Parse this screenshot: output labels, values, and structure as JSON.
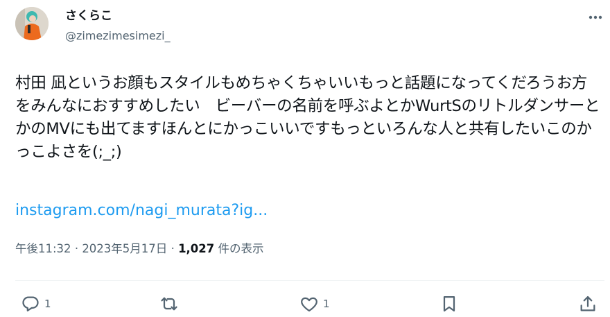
{
  "author": {
    "display_name": "さくらこ",
    "handle": "@zimezimesimezi_"
  },
  "tweet": {
    "text": "村田 凪というお顔もスタイルもめちゃくちゃいいもっと話題になってくだろうお方をみんなにおすすめしたい　ビーバーの名前を呼ぶよとかWurtSのリトルダンサーとかのMVにも出てますほんとにかっこいいですもっといろんな人と共有したいこのかっこよさを(;_;)",
    "link_text": "instagram.com/nagi_murata?ig...",
    "time": "午後11:32",
    "separator": "·",
    "date": "2023年5月17日",
    "views_count": "1,027",
    "views_label": "件の表示"
  },
  "actions": {
    "reply_count": "1",
    "like_count": "1"
  },
  "icons": [
    "more-icon",
    "reply-icon",
    "retweet-icon",
    "like-icon",
    "bookmark-icon",
    "share-icon"
  ],
  "colors": {
    "text": "#0f1419",
    "secondary": "#536471",
    "link": "#1d9bf0",
    "divider": "#eff3f4"
  }
}
